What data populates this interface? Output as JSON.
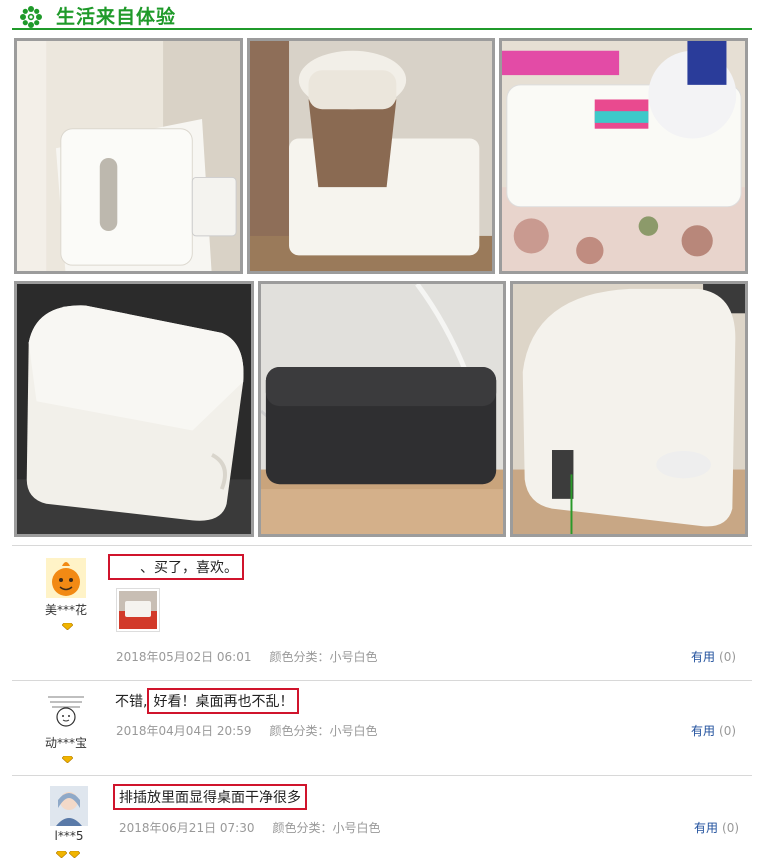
{
  "section": {
    "title": "生活来自体验",
    "logo_icon": "green-flower-icon"
  },
  "photos": [
    {
      "name": "photo-1",
      "alt": "white cable box beside router"
    },
    {
      "name": "photo-2",
      "alt": "white cable box under brown bin"
    },
    {
      "name": "photo-3",
      "alt": "white cable box on floral cloth"
    },
    {
      "name": "photo-4",
      "alt": "white cable box on dark floor"
    },
    {
      "name": "photo-5",
      "alt": "black cable box"
    },
    {
      "name": "photo-6",
      "alt": "white cable box on wood floor"
    }
  ],
  "reviews": [
    {
      "nick": "美***花",
      "pre": "",
      "text": "、买了，喜欢。",
      "date": "2018年05月02日 06:01",
      "spec": "颜色分类：小号白色",
      "useful_label": "有用",
      "useful_count": "(0)",
      "gems": 1
    },
    {
      "nick": "动***宝",
      "pre": "不错,",
      "text": "好看！桌面再也不乱！",
      "date": "2018年04月04日 20:59",
      "spec": "颜色分类：小号白色",
      "useful_label": "有用",
      "useful_count": "(0)",
      "gems": 1
    },
    {
      "nick": "l***5",
      "pre": "",
      "text": "排插放里面显得桌面干净很多",
      "date": "2018年06月21日 07:30",
      "spec": "颜色分类：小号白色",
      "useful_label": "有用",
      "useful_count": "(0)",
      "gems": 2
    }
  ],
  "colors": {
    "accent": "#1f9a2a",
    "highlight": "#d0142c",
    "link": "#1f4f9c"
  }
}
